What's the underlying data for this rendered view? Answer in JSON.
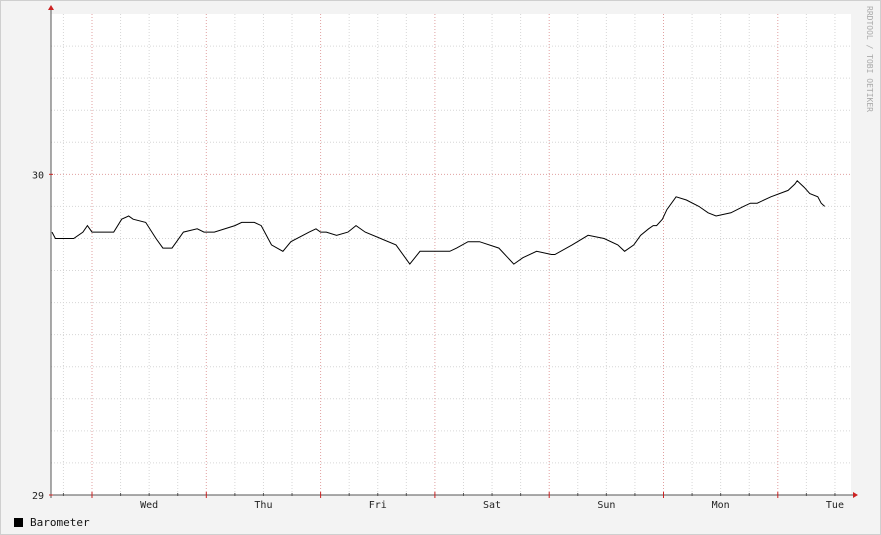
{
  "chart_data": {
    "type": "line",
    "title": "",
    "xlabel": "",
    "ylabel": "",
    "x_tick_labels": [
      "Wed",
      "Thu",
      "Fri",
      "Sat",
      "Sun",
      "Mon",
      "Tue"
    ],
    "x_days_range": [
      0,
      7
    ],
    "y_ticks": [
      29,
      30
    ],
    "ylim": [
      29,
      30.5
    ],
    "grid": true,
    "legend_position": "bottom-left",
    "series": [
      {
        "name": "Barometer",
        "color": "#000000",
        "x_days": [
          0.0,
          0.04,
          0.2,
          0.28,
          0.32,
          0.36,
          0.55,
          0.62,
          0.68,
          0.72,
          0.83,
          0.92,
          0.98,
          1.06,
          1.1,
          1.16,
          1.28,
          1.34,
          1.43,
          1.61,
          1.67,
          1.78,
          1.84,
          1.93,
          2.03,
          2.1,
          2.26,
          2.32,
          2.36,
          2.41,
          2.5,
          2.6,
          2.67,
          2.75,
          3.02,
          3.14,
          3.23,
          3.36,
          3.49,
          3.55,
          3.65,
          3.75,
          3.92,
          4.05,
          4.13,
          4.25,
          4.38,
          4.41,
          4.56,
          4.7,
          4.84,
          4.96,
          5.02,
          5.1,
          5.16,
          5.23,
          5.27,
          5.3,
          5.35,
          5.39,
          5.47,
          5.56,
          5.67,
          5.75,
          5.82,
          5.95,
          6.06,
          6.12,
          6.18,
          6.3,
          6.45,
          6.51,
          6.53,
          6.59,
          6.64,
          6.71,
          6.74,
          6.77
        ],
        "values": [
          29.82,
          29.8,
          29.8,
          29.82,
          29.84,
          29.82,
          29.82,
          29.86,
          29.87,
          29.86,
          29.85,
          29.8,
          29.77,
          29.77,
          29.79,
          29.82,
          29.83,
          29.82,
          29.82,
          29.84,
          29.85,
          29.85,
          29.84,
          29.78,
          29.76,
          29.79,
          29.82,
          29.83,
          29.82,
          29.82,
          29.81,
          29.82,
          29.84,
          29.82,
          29.78,
          29.72,
          29.76,
          29.76,
          29.76,
          29.77,
          29.79,
          29.79,
          29.77,
          29.72,
          29.74,
          29.76,
          29.75,
          29.75,
          29.78,
          29.81,
          29.8,
          29.78,
          29.76,
          29.78,
          29.81,
          29.83,
          29.84,
          29.84,
          29.86,
          29.89,
          29.93,
          29.92,
          29.9,
          29.88,
          29.87,
          29.88,
          29.9,
          29.91,
          29.91,
          29.93,
          29.95,
          29.97,
          29.98,
          29.96,
          29.94,
          29.93,
          29.91,
          29.9
        ]
      }
    ]
  },
  "watermark": "RRDTOOL / TOBI OETIKER",
  "legend": {
    "label": "Barometer",
    "swatch_color": "#000000"
  },
  "colors": {
    "major_grid": "#e0a0a0",
    "minor_grid": "#d6d6d6",
    "axis": "#555555",
    "arrow": "#cc2222",
    "plot_background": "#ffffff",
    "canvas_background": "#f3f3f3"
  }
}
